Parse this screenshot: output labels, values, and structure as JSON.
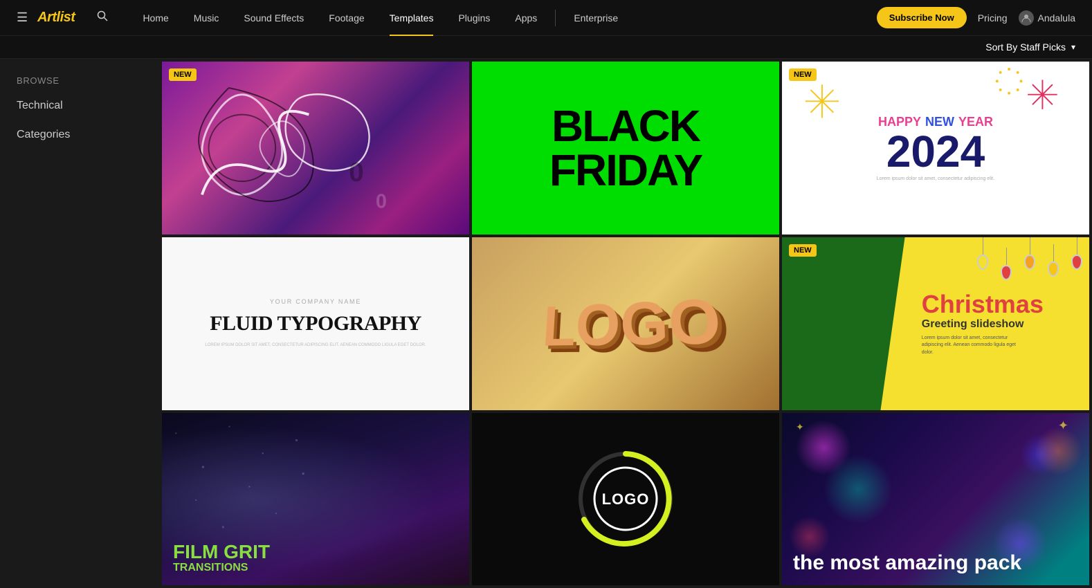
{
  "nav": {
    "logo": "Artlist",
    "links": [
      {
        "label": "Home",
        "active": false
      },
      {
        "label": "Music",
        "active": false
      },
      {
        "label": "Sound Effects",
        "active": false
      },
      {
        "label": "Footage",
        "active": false
      },
      {
        "label": "Templates",
        "active": true
      },
      {
        "label": "Plugins",
        "active": false
      },
      {
        "label": "Apps",
        "active": false
      },
      {
        "label": "Enterprise",
        "active": false
      }
    ],
    "subscribe_label": "Subscribe Now",
    "pricing_label": "Pricing",
    "user_label": "Andalula"
  },
  "sort": {
    "label": "Sort By Staff Picks"
  },
  "sidebar": {
    "browse_label": "Browse",
    "items": [
      {
        "label": "Technical"
      },
      {
        "label": "Categories"
      }
    ]
  },
  "grid": {
    "items": [
      {
        "id": 1,
        "is_new": true,
        "type": "abstract"
      },
      {
        "id": 2,
        "is_new": false,
        "type": "blackfriday"
      },
      {
        "id": 3,
        "is_new": true,
        "type": "newyear"
      },
      {
        "id": 4,
        "is_new": false,
        "type": "fluid"
      },
      {
        "id": 5,
        "is_new": false,
        "type": "logo3d"
      },
      {
        "id": 6,
        "is_new": true,
        "type": "christmas"
      },
      {
        "id": 7,
        "is_new": false,
        "type": "filmgrit"
      },
      {
        "id": 8,
        "is_new": false,
        "type": "logocircle"
      },
      {
        "id": 9,
        "is_new": false,
        "type": "amazing"
      }
    ]
  },
  "badges": {
    "new": "NEW"
  },
  "thumbnails": {
    "blackfriday": "BLACK FRIDAY",
    "newyear_line1": "HAPPY NEW YEAR",
    "newyear_year": "2024",
    "fluid_company": "YOUR COMPANY NAME",
    "fluid_main": "FLUID TYPOGRAPHY",
    "fluid_body": "LOREM IPSUM DOLOR SIT AMET, CONSECTETUR ADIPISCING ELIT. AENEAN COMMODO LIGULA EGET DOLOR.",
    "christmas_title": "Christmas",
    "christmas_sub": "Greeting slideshow",
    "christmas_body": "Lorem ipsum dolor sit amet, consectetur adipiscing elit. Aenean commodo ligula eget dolor.",
    "filmgrit_main": "FILM GRIT",
    "filmgrit_sub": "TRANSITIONS",
    "amazing_text": "the most amazing pack",
    "logo3d_text": "LOGO",
    "logocircle_text": "LOGO"
  }
}
